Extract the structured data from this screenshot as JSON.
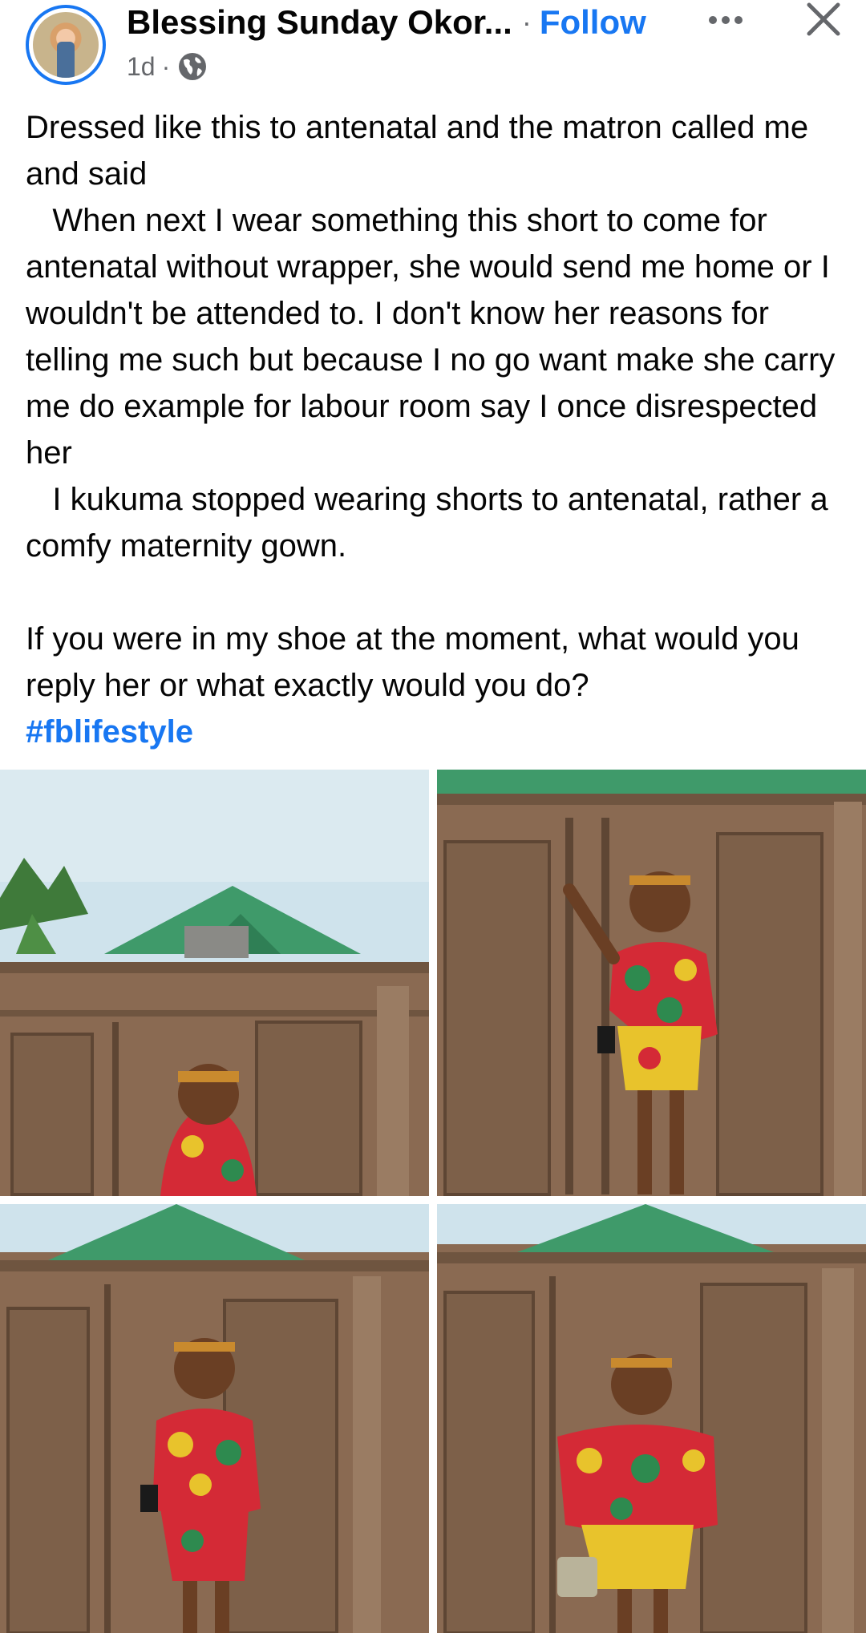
{
  "post": {
    "author": "Blessing Sunday Okor...",
    "separator": "·",
    "follow_label": "Follow",
    "time": "1d",
    "time_separator": "·",
    "privacy_icon": "globe-icon",
    "more_icon": "more-horizontal-icon",
    "close_icon": "close-icon",
    "text": "Dressed like this to antenatal and the matron called me and said\n   When next I wear something this short to come for antenatal without wrapper, she would send me home or I wouldn't be attended to. I don't know her reasons for telling me such but because I no go want make she carry me do example for labour room say I once disrespected her\n   I kukuma stopped wearing shorts to antenatal, rather a comfy maternity gown.\n\nIf you were in my shoe at the moment, what would you reply her or what exactly would you do?",
    "hashtag": "#fblifestyle"
  },
  "colors": {
    "accent": "#1877f2",
    "text": "#050505",
    "secondary_text": "#65676b",
    "gate": "#8a6a52",
    "roof": "#3f9a6a",
    "sky": "#cfe3ec",
    "dress_red": "#d42a36",
    "dress_yellow": "#e8c32c",
    "dress_green": "#2e8a4f"
  }
}
